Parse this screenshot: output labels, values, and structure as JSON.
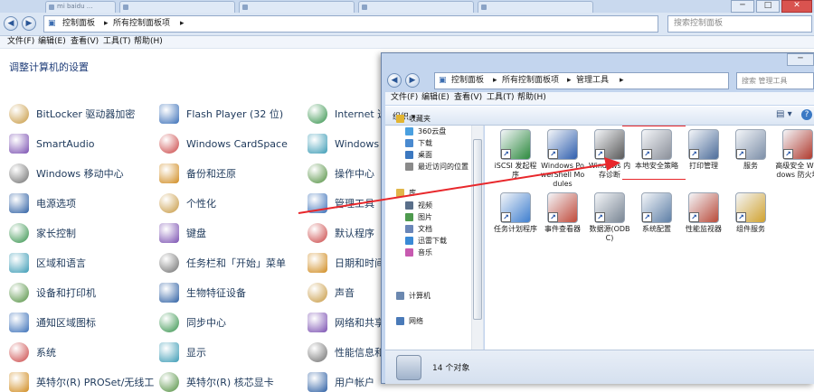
{
  "background_window": {
    "tabs": [
      "mi baidu ...",
      "",
      "",
      "",
      ""
    ],
    "address": [
      "控制面板",
      "所有控制面板项"
    ],
    "search_placeholder": "搜索控制面板",
    "menu": [
      "文件(F)",
      "编辑(E)",
      "查看(V)",
      "工具(T)",
      "帮助(H)"
    ],
    "heading": "调整计算机的设置",
    "items": [
      {
        "label": "BitLocker 驱动器加密",
        "icon": "bitlocker-icon"
      },
      {
        "label": "Flash Player (32 位)",
        "icon": "flash-icon"
      },
      {
        "label": "Internet 选",
        "icon": "internet-options-icon"
      },
      {
        "label": "SmartAudio",
        "icon": "smartaudio-icon"
      },
      {
        "label": "Windows CardSpace",
        "icon": "cardspace-icon"
      },
      {
        "label": "Windows",
        "icon": "windows-icon"
      },
      {
        "label": "Windows 移动中心",
        "icon": "mobility-center-icon"
      },
      {
        "label": "备份和还原",
        "icon": "backup-icon"
      },
      {
        "label": "操作中心",
        "icon": "action-center-icon"
      },
      {
        "label": "电源选项",
        "icon": "power-icon"
      },
      {
        "label": "个性化",
        "icon": "personalization-icon"
      },
      {
        "label": "管理工具",
        "icon": "admin-tools-icon"
      },
      {
        "label": "家长控制",
        "icon": "parental-controls-icon"
      },
      {
        "label": "键盘",
        "icon": "keyboard-icon"
      },
      {
        "label": "默认程序",
        "icon": "default-programs-icon"
      },
      {
        "label": "区域和语言",
        "icon": "region-icon"
      },
      {
        "label": "任务栏和「开始」菜单",
        "icon": "taskbar-icon"
      },
      {
        "label": "日期和时间",
        "icon": "datetime-icon"
      },
      {
        "label": "设备和打印机",
        "icon": "devices-printers-icon"
      },
      {
        "label": "生物特征设备",
        "icon": "biometric-icon"
      },
      {
        "label": "声音",
        "icon": "sound-icon"
      },
      {
        "label": "通知区域图标",
        "icon": "notification-icon"
      },
      {
        "label": "同步中心",
        "icon": "sync-center-icon"
      },
      {
        "label": "网络和共享",
        "icon": "network-icon"
      },
      {
        "label": "系统",
        "icon": "system-icon"
      },
      {
        "label": "显示",
        "icon": "display-icon"
      },
      {
        "label": "性能信息和",
        "icon": "performance-icon"
      },
      {
        "label": "英特尔(R) PROSet/无线工",
        "icon": "wireless-icon"
      },
      {
        "label": "英特尔(R) 核芯显卡",
        "icon": "intel-graphics-icon"
      },
      {
        "label": "用户帐户",
        "icon": "user-accounts-icon"
      }
    ]
  },
  "admin_window": {
    "address": [
      "控制面板",
      "所有控制面板项",
      "管理工具"
    ],
    "search_placeholder": "搜索 管理工具",
    "menu": [
      "文件(F)",
      "编辑(E)",
      "查看(V)",
      "工具(T)",
      "帮助(H)"
    ],
    "organize_label": "组织 ▾",
    "nav": [
      {
        "label": "收藏夹",
        "icon": "favorites-icon",
        "level": 0
      },
      {
        "label": "360云盘",
        "icon": "cloud-icon",
        "level": 1
      },
      {
        "label": "下载",
        "icon": "download-icon",
        "level": 1
      },
      {
        "label": "桌面",
        "icon": "desktop-icon",
        "level": 1
      },
      {
        "label": "最近访问的位置",
        "icon": "recent-icon",
        "level": 1
      },
      {
        "label": "库",
        "icon": "library-icon",
        "level": 0
      },
      {
        "label": "视频",
        "icon": "video-icon",
        "level": 1
      },
      {
        "label": "图片",
        "icon": "pictures-icon",
        "level": 1
      },
      {
        "label": "文档",
        "icon": "documents-icon",
        "level": 1
      },
      {
        "label": "迅雷下载",
        "icon": "thunder-icon",
        "level": 1
      },
      {
        "label": "音乐",
        "icon": "music-icon",
        "level": 1
      },
      {
        "label": "计算机",
        "icon": "computer-icon",
        "level": 0
      },
      {
        "label": "网络",
        "icon": "network-icon",
        "level": 0
      }
    ],
    "tools": [
      {
        "label": "iSCSI 发起程序",
        "icon": "iscsi-icon"
      },
      {
        "label": "Windows PowerShell Modules",
        "icon": "powershell-icon"
      },
      {
        "label": "Windows 内存诊断",
        "icon": "memory-diagnostic-icon"
      },
      {
        "label": "本地安全策略",
        "icon": "local-security-policy-icon"
      },
      {
        "label": "打印管理",
        "icon": "print-management-icon"
      },
      {
        "label": "服务",
        "icon": "services-icon"
      },
      {
        "label": "高级安全 Windows 防火墙",
        "icon": "firewall-icon"
      },
      {
        "label": "任务计划程序",
        "icon": "task-scheduler-icon"
      },
      {
        "label": "事件查看器",
        "icon": "event-viewer-icon"
      },
      {
        "label": "数据源(ODBC)",
        "icon": "odbc-icon"
      },
      {
        "label": "系统配置",
        "icon": "system-config-icon"
      },
      {
        "label": "性能监视器",
        "icon": "performance-monitor-icon"
      },
      {
        "label": "组件服务",
        "icon": "component-services-icon"
      }
    ],
    "status": "14 个对象"
  },
  "colors": {
    "annotation": "#e8272b",
    "link": "#1e395b"
  }
}
